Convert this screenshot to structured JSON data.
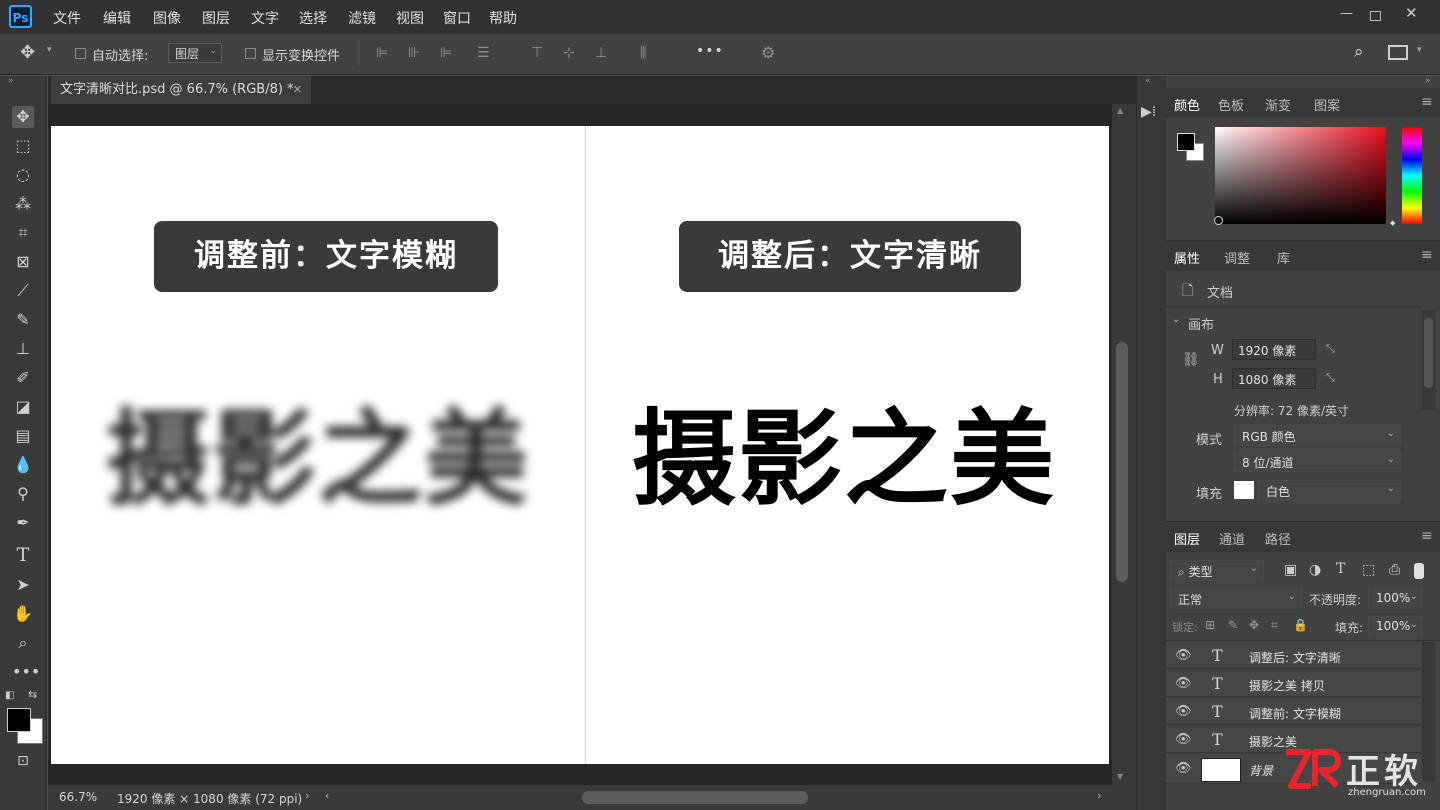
{
  "app": {
    "logo": "Ps",
    "menu": [
      "文件",
      "编辑",
      "图像",
      "图层",
      "文字",
      "选择",
      "滤镜",
      "视图",
      "窗口",
      "帮助"
    ]
  },
  "options": {
    "auto_select_label": "自动选择:",
    "auto_select_value": "图层",
    "show_transform_label": "显示变换控件",
    "more": "•••"
  },
  "document": {
    "tab_title": "文字清晰对比.psd @ 66.7% (RGB/8) *",
    "zoom": "66.7%",
    "info": "1920 像素 × 1080 像素 (72 ppi)"
  },
  "artboard": {
    "left_label": "调整前：文字模糊",
    "right_label": "调整后：文字清晰",
    "left_text": "摄影之美",
    "right_text": "摄影之美"
  },
  "color_panel": {
    "tabs": [
      "颜色",
      "色板",
      "渐变",
      "图案"
    ],
    "foreground": "#000000",
    "background": "#ffffff",
    "hue_base": "#e8101f"
  },
  "properties_panel": {
    "tabs": [
      "属性",
      "调整",
      "库"
    ],
    "doc_label": "文档",
    "canvas_section": "画布",
    "w_label": "W",
    "w_value": "1920 像素",
    "h_label": "H",
    "h_value": "1080 像素",
    "resolution": "分辨率: 72 像素/英寸",
    "mode_label": "模式",
    "mode_value": "RGB 颜色",
    "depth_value": "8 位/通道",
    "fill_label": "填充",
    "fill_value": "白色"
  },
  "layers_panel": {
    "tabs": [
      "图层",
      "通道",
      "路径"
    ],
    "filter_kind": "类型",
    "blend_mode": "正常",
    "opacity_label": "不透明度:",
    "opacity_value": "100%",
    "lock_label": "锁定:",
    "fill_label": "填充:",
    "fill_value": "100%",
    "layers": [
      {
        "type": "T",
        "name": "调整后: 文字清晰"
      },
      {
        "type": "T",
        "name": "摄影之美 拷贝"
      },
      {
        "type": "T",
        "name": "调整前: 文字模糊"
      },
      {
        "type": "T",
        "name": "摄影之美"
      },
      {
        "type": "image",
        "name": "背景"
      }
    ]
  },
  "watermark": {
    "text": "正软",
    "url": "zhengruan.com"
  }
}
